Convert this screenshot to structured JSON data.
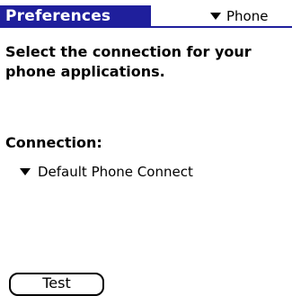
{
  "app": {
    "title": "Preferences",
    "category": "Phone"
  },
  "content": {
    "instruction": "Select the connection for your phone applications.",
    "instruction_line1": "Select the connection for your",
    "instruction_line2": "phone applications.",
    "connection_label": "Connection:",
    "connection_value": "Default Phone Connect"
  },
  "buttons": {
    "test_label": "Test"
  },
  "colors": {
    "titlebar": "#1f1f9c",
    "background": "#ffffff",
    "text": "#000000"
  },
  "icons": {
    "category_dropdown": "triangle-down-icon",
    "connection_dropdown": "triangle-down-icon"
  }
}
